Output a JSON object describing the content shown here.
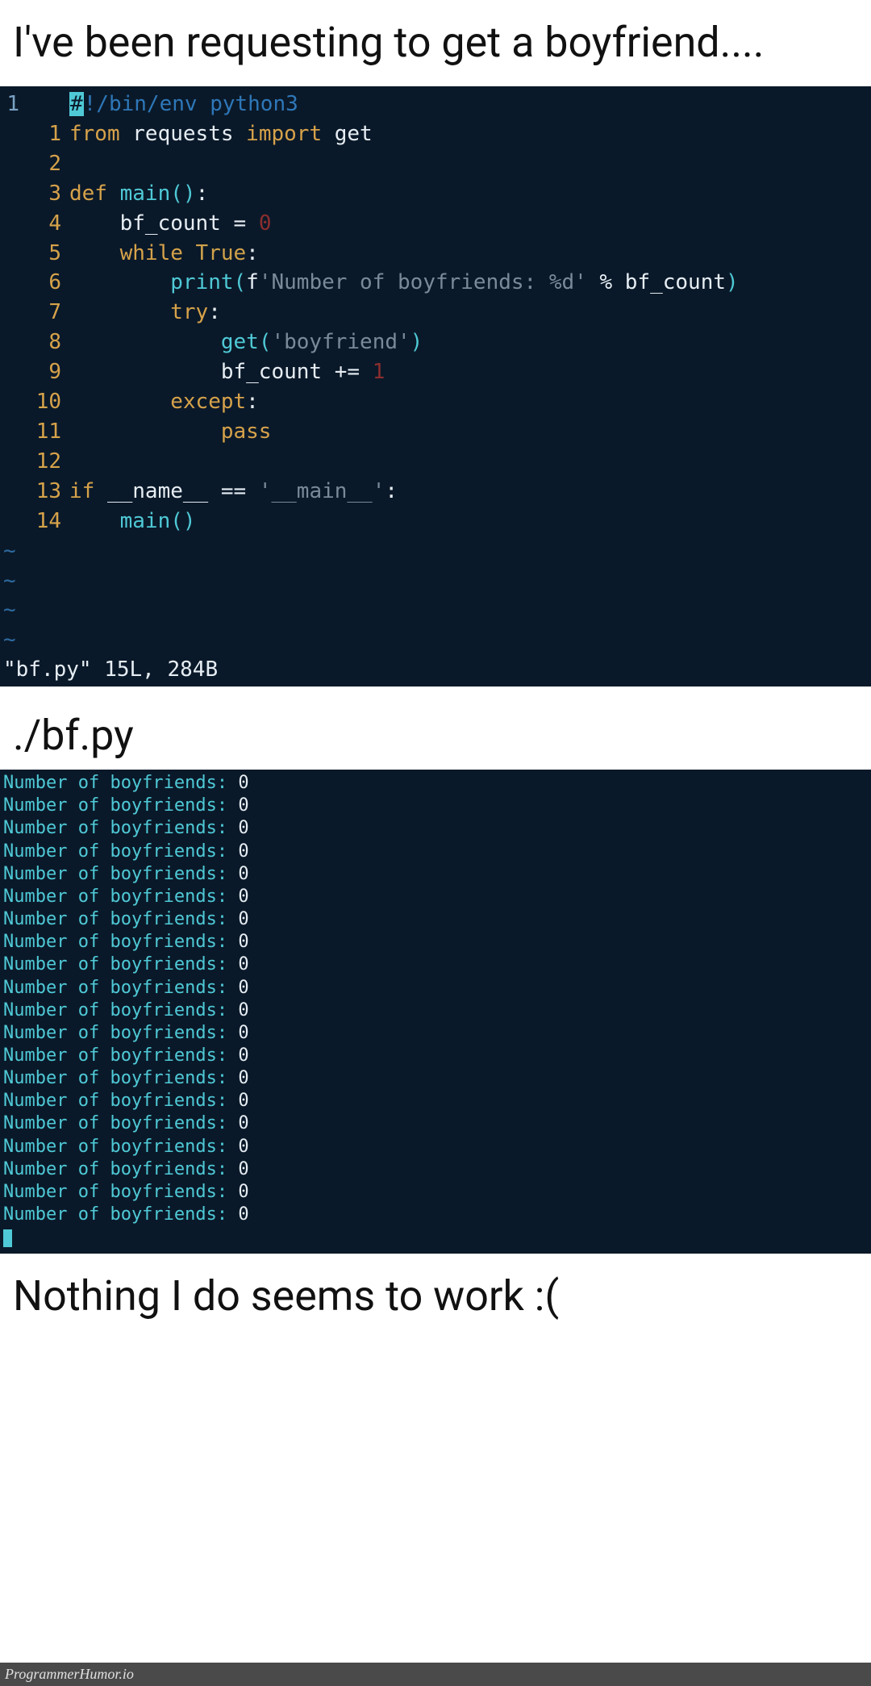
{
  "caption_top": "I've been requesting to get a boyfriend....",
  "caption_mid": "./bf.py",
  "caption_bottom": "Nothing I do seems to work :(",
  "footer": "ProgrammerHumor.io",
  "editor": {
    "outer_gutter_first": "1",
    "tildes": [
      "~",
      "~",
      "~",
      "~"
    ],
    "status": "\"bf.py\" 15L, 284B",
    "lines": [
      {
        "n": "",
        "tokens": [
          [
            "cursor-hash",
            "#"
          ],
          [
            "tok-comment",
            "!/bin/env python3"
          ]
        ]
      },
      {
        "n": "1",
        "tokens": [
          [
            "tok-keyword",
            "from "
          ],
          [
            "tok-ident",
            "requests "
          ],
          [
            "tok-keyword",
            "import "
          ],
          [
            "tok-ident",
            "get"
          ]
        ]
      },
      {
        "n": "2",
        "tokens": []
      },
      {
        "n": "3",
        "tokens": [
          [
            "tok-keyword",
            "def "
          ],
          [
            "tok-builtin",
            "main"
          ],
          [
            "tok-paren",
            "()"
          ],
          [
            "tok-op",
            ":"
          ]
        ]
      },
      {
        "n": "4",
        "tokens": [
          [
            "tok-ident",
            "    bf_count "
          ],
          [
            "tok-op",
            "= "
          ],
          [
            "tok-number",
            "0"
          ]
        ]
      },
      {
        "n": "5",
        "tokens": [
          [
            "tok-ident",
            "    "
          ],
          [
            "tok-keyword",
            "while "
          ],
          [
            "tok-const",
            "True"
          ],
          [
            "tok-op",
            ":"
          ]
        ]
      },
      {
        "n": "6",
        "tokens": [
          [
            "tok-ident",
            "        "
          ],
          [
            "tok-builtin",
            "print"
          ],
          [
            "tok-paren",
            "("
          ],
          [
            "tok-ident",
            "f"
          ],
          [
            "tok-string",
            "'Number of boyfriends: %d'"
          ],
          [
            "tok-ident",
            " "
          ],
          [
            "tok-op",
            "%"
          ],
          [
            "tok-ident",
            " bf_count"
          ],
          [
            "tok-paren",
            ")"
          ]
        ]
      },
      {
        "n": "7",
        "tokens": [
          [
            "tok-ident",
            "        "
          ],
          [
            "tok-keyword",
            "try"
          ],
          [
            "tok-op",
            ":"
          ]
        ]
      },
      {
        "n": "8",
        "tokens": [
          [
            "tok-ident",
            "            "
          ],
          [
            "tok-builtin",
            "get"
          ],
          [
            "tok-paren",
            "("
          ],
          [
            "tok-string",
            "'boyfriend'"
          ],
          [
            "tok-paren",
            ")"
          ]
        ]
      },
      {
        "n": "9",
        "tokens": [
          [
            "tok-ident",
            "            bf_count "
          ],
          [
            "tok-op",
            "+= "
          ],
          [
            "tok-number",
            "1"
          ]
        ]
      },
      {
        "n": "10",
        "tokens": [
          [
            "tok-ident",
            "        "
          ],
          [
            "tok-keyword",
            "except"
          ],
          [
            "tok-op",
            ":"
          ]
        ]
      },
      {
        "n": "11",
        "tokens": [
          [
            "tok-ident",
            "            "
          ],
          [
            "tok-keyword",
            "pass"
          ]
        ]
      },
      {
        "n": "12",
        "tokens": []
      },
      {
        "n": "13",
        "tokens": [
          [
            "tok-keyword",
            "if "
          ],
          [
            "tok-ident",
            "__name__ "
          ],
          [
            "tok-op",
            "== "
          ],
          [
            "tok-string",
            "'__main__'"
          ],
          [
            "tok-op",
            ":"
          ]
        ]
      },
      {
        "n": "14",
        "tokens": [
          [
            "tok-ident",
            "    "
          ],
          [
            "tok-builtin",
            "main"
          ],
          [
            "tok-paren",
            "()"
          ]
        ]
      }
    ]
  },
  "terminal": {
    "label": "Number of boyfriends: ",
    "value": "0",
    "repeat": 20
  }
}
